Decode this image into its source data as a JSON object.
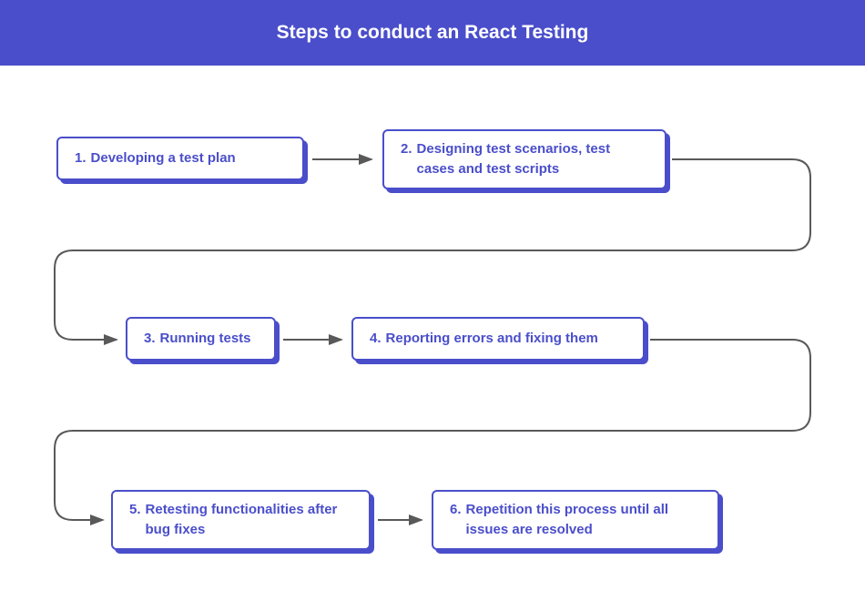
{
  "header": {
    "title": "Steps to conduct an React Testing"
  },
  "colors": {
    "primary": "#4a4eca",
    "connector": "#595959"
  },
  "steps": [
    {
      "num": "1.",
      "label": "Developing a test plan"
    },
    {
      "num": "2.",
      "label": "Designing test scenarios, test cases and test scripts"
    },
    {
      "num": "3.",
      "label": "Running tests"
    },
    {
      "num": "4.",
      "label": "Reporting errors and fixing them"
    },
    {
      "num": "5.",
      "label": "Retesting functionalities after bug fixes"
    },
    {
      "num": "6.",
      "label": "Repetition this process until all issues are resolved"
    }
  ]
}
